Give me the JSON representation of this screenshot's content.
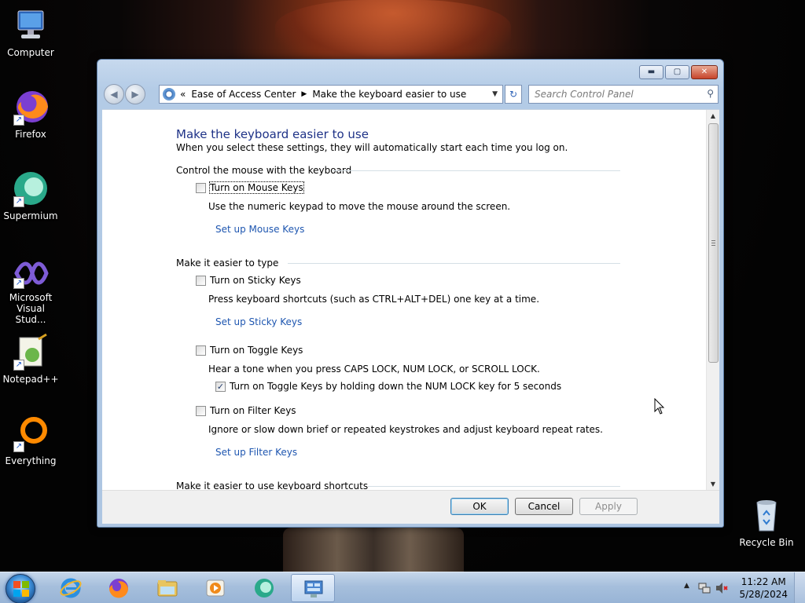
{
  "desktop": {
    "icons": [
      {
        "label": "Computer",
        "icon": "computer-icon"
      },
      {
        "label": "Firefox",
        "icon": "firefox-icon"
      },
      {
        "label": "Supermium",
        "icon": "supermium-icon"
      },
      {
        "label": "Microsoft Visual Stud...",
        "icon": "visual-studio-icon"
      },
      {
        "label": "Notepad++",
        "icon": "notepad-plus-plus-icon"
      },
      {
        "label": "Everything",
        "icon": "everything-icon"
      },
      {
        "label": "Recycle Bin",
        "icon": "recycle-bin-icon"
      }
    ]
  },
  "window": {
    "buttons": {
      "minimize": "▬",
      "maximize": "▢",
      "close": "✕"
    },
    "nav": {
      "back": "◀",
      "forward": "▶"
    },
    "address": {
      "prefix": "«",
      "crumbs": [
        "Ease of Access Center",
        "Make the keyboard easier to use"
      ],
      "separator": "▶",
      "dropdown": "▼"
    },
    "refresh": "↻",
    "search": {
      "placeholder": "Search Control Panel",
      "icon": "search-icon",
      "glyph": "⚲"
    }
  },
  "page": {
    "title": "Make the keyboard easier to use",
    "subtitle": "When you select these settings, they will automatically start each time you log on.",
    "sections": {
      "mouse": {
        "heading": "Control the mouse with the keyboard",
        "checkbox": {
          "label": "Turn on Mouse Keys",
          "checked": false
        },
        "description": "Use the numeric keypad to move the mouse around the screen.",
        "link": "Set up Mouse Keys"
      },
      "typing": {
        "heading": "Make it easier to type",
        "sticky": {
          "label": "Turn on Sticky Keys",
          "checked": false,
          "description": "Press keyboard shortcuts (such as CTRL+ALT+DEL) one key at a time.",
          "link": "Set up Sticky Keys"
        },
        "toggle": {
          "label": "Turn on Toggle Keys",
          "checked": false,
          "description": "Hear a tone when you press CAPS LOCK, NUM LOCK, or SCROLL LOCK.",
          "sub_checkbox": {
            "label": "Turn on Toggle Keys by holding down the NUM LOCK key for 5 seconds",
            "checked": true
          }
        },
        "filter": {
          "label": "Turn on Filter Keys",
          "checked": false,
          "description": "Ignore or slow down brief or repeated keystrokes and adjust keyboard repeat rates.",
          "link": "Set up Filter Keys"
        }
      },
      "shortcuts": {
        "heading": "Make it easier to use keyboard shortcuts"
      }
    },
    "check_mark": "✓"
  },
  "footer": {
    "ok": "OK",
    "cancel": "Cancel",
    "apply": "Apply",
    "apply_enabled": false
  },
  "scrollbar": {
    "up": "▲",
    "down": "▼"
  },
  "taskbar": {
    "items": [
      {
        "icon": "internet-explorer-icon"
      },
      {
        "icon": "firefox-icon"
      },
      {
        "icon": "file-explorer-icon"
      },
      {
        "icon": "media-player-icon"
      },
      {
        "icon": "supermium-icon"
      },
      {
        "icon": "control-panel-icon",
        "active": true
      }
    ],
    "tray": {
      "show_hidden": "▲",
      "time": "11:22 AM",
      "date": "5/28/2024"
    }
  }
}
